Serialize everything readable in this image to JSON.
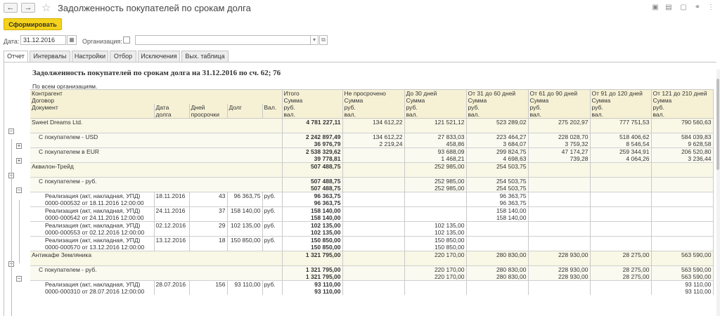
{
  "window": {
    "title": "Задолженность покупателей по срокам долга"
  },
  "toolbar": {
    "back_label": "←",
    "forward_label": "→",
    "generate_label": "Сформировать"
  },
  "filters": {
    "date_label": "Дата:",
    "date_value": "31.12.2016",
    "org_label": "Организация:",
    "org_value": ""
  },
  "tabs": [
    "Отчет",
    "Интервалы",
    "Настройки",
    "Отбор",
    "Исключения",
    "Вых. таблица"
  ],
  "report": {
    "title": "Задолженность покупателей по срокам долга на 31.12.2016  по сч. 62; 76",
    "subtitle": "По всем организациям.",
    "header": {
      "kontragent": "Контрагент",
      "dogovor": "Договор",
      "dokument": "Документ",
      "data_dolga": [
        "Дата",
        "долга"
      ],
      "dney": [
        "Дней",
        "просрочки"
      ],
      "dolg": "Долг",
      "val": "Вал.",
      "buckets": [
        {
          "name": "Итого",
          "sum": "Сумма",
          "cur1": "руб.",
          "cur2": "вал."
        },
        {
          "name": "Не просрочено",
          "sum": "Сумма",
          "cur1": "руб.",
          "cur2": "вал."
        },
        {
          "name": "До 30 дней",
          "sum": "Сумма",
          "cur1": "руб.",
          "cur2": "вал."
        },
        {
          "name": "От 31 до 60 дней",
          "sum": "Сумма",
          "cur1": "руб.",
          "cur2": "вал."
        },
        {
          "name": "От 61 до 90 дней",
          "sum": "Сумма",
          "cur1": "руб.",
          "cur2": "вал."
        },
        {
          "name": "От 91 до 120 дней",
          "sum": "Сумма",
          "cur1": "руб.",
          "cur2": "вал."
        },
        {
          "name": "От 121 до 210 дней",
          "sum": "Сумма",
          "cur1": "руб.",
          "cur2": "вал."
        }
      ]
    },
    "rows": [
      {
        "kind": "cp",
        "lines": [
          [
            "Sweet Dreams Ltd.",
            ""
          ],
          [
            "",
            ""
          ]
        ],
        "doc": [
          "",
          ""
        ],
        "dd": "",
        "days": "",
        "debt": "",
        "val": "",
        "b": [
          [
            "4 781 227,11",
            ""
          ],
          [
            "134 612,22",
            ""
          ],
          [
            "121 521,12",
            ""
          ],
          [
            "523 289,02",
            ""
          ],
          [
            "275 202,97",
            ""
          ],
          [
            "777 751,53",
            ""
          ],
          [
            "790 560,63",
            ""
          ]
        ]
      },
      {
        "kind": "ct",
        "lines": [
          [
            "С покупателем - USD",
            ""
          ]
        ],
        "doc": [
          "",
          ""
        ],
        "dd": "",
        "days": "",
        "debt": "",
        "val": "",
        "b": [
          [
            "2 242 897,49",
            "36 976,79"
          ],
          [
            "134 612,22",
            "2 219,24"
          ],
          [
            "27 833,03",
            "458,86"
          ],
          [
            "223 464,27",
            "3 684,07"
          ],
          [
            "228 028,70",
            "3 759,32"
          ],
          [
            "518 406,62",
            "8 546,54"
          ],
          [
            "584 039,83",
            "9 628,58"
          ]
        ]
      },
      {
        "kind": "ct",
        "lines": [
          [
            "С покупателем в EUR",
            ""
          ]
        ],
        "doc": [
          "",
          ""
        ],
        "dd": "",
        "days": "",
        "debt": "",
        "val": "",
        "b": [
          [
            "2 538 329,62",
            "39 778,81"
          ],
          [
            "",
            ""
          ],
          [
            "93 688,09",
            "1 468,21"
          ],
          [
            "299 824,75",
            "4 698,63"
          ],
          [
            "47 174,27",
            "739,28"
          ],
          [
            "259 344,91",
            "4 064,26"
          ],
          [
            "206 520,80",
            "3 236,44"
          ]
        ]
      },
      {
        "kind": "cp",
        "lines": [
          [
            "Аквилон-Трейд",
            ""
          ]
        ],
        "doc": [
          "",
          ""
        ],
        "dd": "",
        "days": "",
        "debt": "",
        "val": "",
        "b": [
          [
            "507 488,75",
            ""
          ],
          [
            "",
            ""
          ],
          [
            "252 985,00",
            ""
          ],
          [
            "254 503,75",
            ""
          ],
          [
            "",
            ""
          ],
          [
            "",
            ""
          ],
          [
            "",
            ""
          ]
        ]
      },
      {
        "kind": "ct",
        "lines": [
          [
            "С покупателем - руб.",
            ""
          ]
        ],
        "doc": [
          "",
          ""
        ],
        "dd": "",
        "days": "",
        "debt": "",
        "val": "",
        "b": [
          [
            "507 488,75",
            "507 488,75"
          ],
          [
            "",
            ""
          ],
          [
            "252 985,00",
            "252 985,00"
          ],
          [
            "254 503,75",
            "254 503,75"
          ],
          [
            "",
            ""
          ],
          [
            "",
            ""
          ],
          [
            "",
            ""
          ]
        ]
      },
      {
        "kind": "doc",
        "doc": [
          "Реализация (акт, накладная, УПД)",
          "0000-000532 от 18.11.2016 12:00:00"
        ],
        "dd": "18.11.2016",
        "days": "43",
        "debt": "96 363,75",
        "val": "руб.",
        "b": [
          [
            "96 363,75",
            "96 363,75"
          ],
          [
            "",
            ""
          ],
          [
            "",
            ""
          ],
          [
            "96 363,75",
            "96 363,75"
          ],
          [
            "",
            ""
          ],
          [
            "",
            ""
          ],
          [
            "",
            ""
          ]
        ]
      },
      {
        "kind": "doc",
        "doc": [
          "Реализация (акт, накладная, УПД)",
          "0000-000542 от 24.11.2016 12:00:00"
        ],
        "dd": "24.11.2016",
        "days": "37",
        "debt": "158 140,00",
        "val": "руб.",
        "b": [
          [
            "158 140,00",
            "158 140,00"
          ],
          [
            "",
            ""
          ],
          [
            "",
            ""
          ],
          [
            "158 140,00",
            "158 140,00"
          ],
          [
            "",
            ""
          ],
          [
            "",
            ""
          ],
          [
            "",
            ""
          ]
        ]
      },
      {
        "kind": "doc",
        "doc": [
          "Реализация (акт, накладная, УПД)",
          "0000-000553 от 02.12.2016 12:00:00"
        ],
        "dd": "02.12.2016",
        "days": "29",
        "debt": "102 135,00",
        "val": "руб.",
        "b": [
          [
            "102 135,00",
            "102 135,00"
          ],
          [
            "",
            ""
          ],
          [
            "102 135,00",
            "102 135,00"
          ],
          [
            "",
            ""
          ],
          [
            "",
            ""
          ],
          [
            "",
            ""
          ],
          [
            "",
            ""
          ]
        ]
      },
      {
        "kind": "doc",
        "doc": [
          "Реализация (акт, накладная, УПД)",
          "0000-000570 от 13.12.2016 12:00:00"
        ],
        "dd": "13.12.2016",
        "days": "18",
        "debt": "150 850,00",
        "val": "руб.",
        "b": [
          [
            "150 850,00",
            "150 850,00"
          ],
          [
            "",
            ""
          ],
          [
            "150 850,00",
            "150 850,00"
          ],
          [
            "",
            ""
          ],
          [
            "",
            ""
          ],
          [
            "",
            ""
          ],
          [
            "",
            ""
          ]
        ]
      },
      {
        "kind": "cp",
        "lines": [
          [
            "Антикафе Земляника",
            ""
          ]
        ],
        "doc": [
          "",
          ""
        ],
        "dd": "",
        "days": "",
        "debt": "",
        "val": "",
        "b": [
          [
            "1 321 795,00",
            ""
          ],
          [
            "",
            ""
          ],
          [
            "220 170,00",
            ""
          ],
          [
            "280 830,00",
            ""
          ],
          [
            "228 930,00",
            ""
          ],
          [
            "28 275,00",
            ""
          ],
          [
            "563 590,00",
            ""
          ]
        ]
      },
      {
        "kind": "ct",
        "lines": [
          [
            "С покупателем - руб.",
            ""
          ]
        ],
        "doc": [
          "",
          ""
        ],
        "dd": "",
        "days": "",
        "debt": "",
        "val": "",
        "b": [
          [
            "1 321 795,00",
            "1 321 795,00"
          ],
          [
            "",
            ""
          ],
          [
            "220 170,00",
            "220 170,00"
          ],
          [
            "280 830,00",
            "280 830,00"
          ],
          [
            "228 930,00",
            "228 930,00"
          ],
          [
            "28 275,00",
            "28 275,00"
          ],
          [
            "563 590,00",
            "563 590,00"
          ]
        ]
      },
      {
        "kind": "doc",
        "doc": [
          "Реализация (акт, накладная, УПД)",
          "0000-000310 от 28.07.2016 12:00:00"
        ],
        "dd": "28.07.2016",
        "days": "156",
        "debt": "93 110,00",
        "val": "руб.",
        "b": [
          [
            "93 110,00",
            "93 110,00"
          ],
          [
            "",
            ""
          ],
          [
            "",
            ""
          ],
          [
            "",
            ""
          ],
          [
            "",
            ""
          ],
          [
            "",
            ""
          ],
          [
            "93 110,00",
            "93 110,00"
          ]
        ]
      }
    ]
  }
}
